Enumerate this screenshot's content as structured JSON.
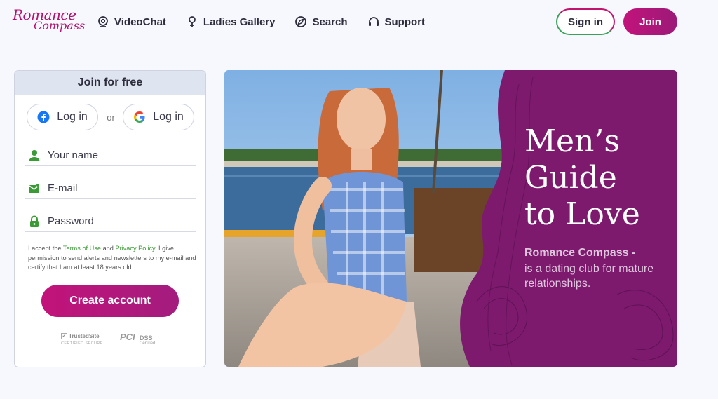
{
  "brand": {
    "logo_line1": "Romance",
    "logo_line2": "Compass",
    "color": "#b5106f"
  },
  "nav": [
    {
      "label": "VideoChat",
      "icon": "webcam-icon"
    },
    {
      "label": "Ladies Gallery",
      "icon": "lady-icon"
    },
    {
      "label": "Search",
      "icon": "search-compass-icon"
    },
    {
      "label": "Support",
      "icon": "headset-icon"
    }
  ],
  "header": {
    "signin_label": "Sign in",
    "join_label": "Join"
  },
  "join_panel": {
    "title": "Join for free",
    "facebook_label": "Log in",
    "or_text": "or",
    "google_label": "Log in",
    "name_placeholder": "Your name",
    "email_placeholder": "E-mail",
    "password_placeholder": "Password",
    "terms_pre": "I accept the ",
    "terms_link": "Terms of Use",
    "terms_and": " and ",
    "privacy_link": "Privacy Policy",
    "terms_post": ". I give permission to send alerts and newsletters to my e-mail and certify that I am at least 18 years old.",
    "create_label": "Create account",
    "trusted_line1": "TrustedSite",
    "trusted_line2": "CERTIFIED SECURE",
    "pci_text": "PCI",
    "pci_dss": "DSS",
    "pci_cert": "Certified"
  },
  "hero": {
    "title_line1": "Men’s",
    "title_line2": "Guide",
    "title_line3": "to Love",
    "brand_text": "Romance Compass -",
    "description": "is a dating club for mature relationships."
  },
  "colors": {
    "accent": "#c2137a",
    "green": "#3a9a35",
    "purple": "#7d1a6e"
  }
}
